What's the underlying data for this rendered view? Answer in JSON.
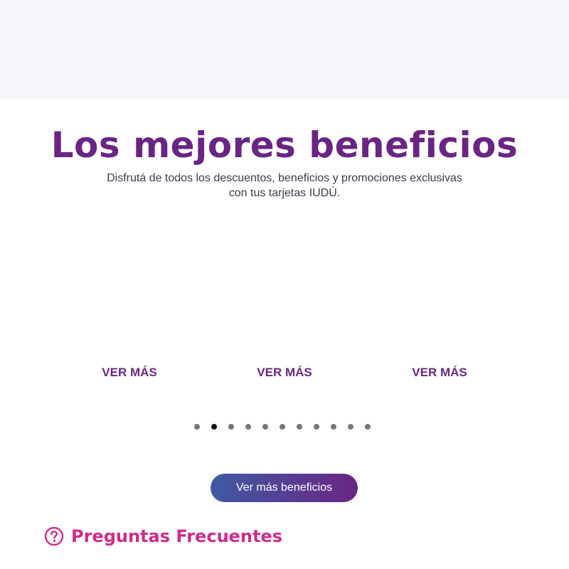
{
  "benefits": {
    "title": "Los mejores beneficios",
    "subtitle_line1": "Disfrutá de todos los descuentos, beneficios y promociones exclusivas",
    "subtitle_line2": "con tus tarjetas IUDÚ.",
    "cards": [
      {
        "link_label": "VER MÁS"
      },
      {
        "link_label": "VER MÁS"
      },
      {
        "link_label": "VER MÁS"
      }
    ],
    "carousel": {
      "page_count": 11,
      "active_index": 1
    },
    "cta_label": "Ver más beneficios"
  },
  "faq": {
    "title": "Preguntas Frecuentes",
    "icon": "question-circle-icon"
  },
  "colors": {
    "brand_purple": "#6a2584",
    "brand_pink": "#d12a8c",
    "cta_gradient_start": "#3f5aa3",
    "cta_gradient_end": "#6a2584",
    "top_band": "#f8f7fb"
  }
}
